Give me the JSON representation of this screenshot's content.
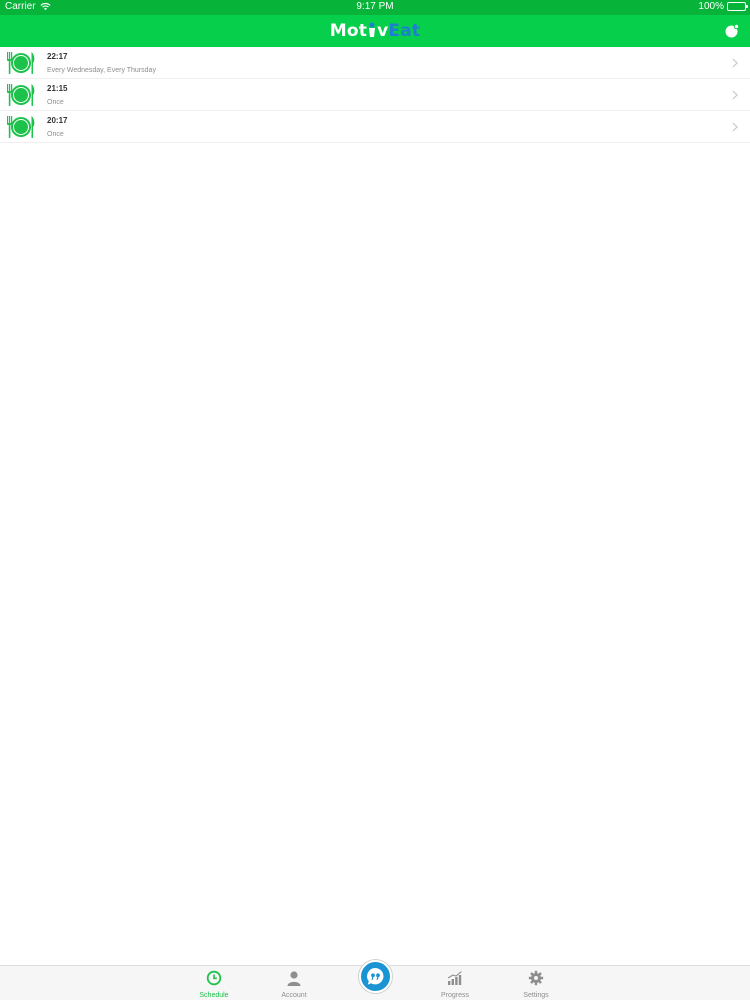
{
  "status_bar": {
    "carrier": "Carrier",
    "time": "9:17 PM",
    "battery": "100%"
  },
  "nav": {
    "logo_part1": "Mot",
    "logo_part2": "v",
    "logo_part3": "Eat",
    "logo_colors": {
      "primary": "#ffffff",
      "secondary": "#1e7fd0"
    },
    "right_icon": "notification-bell-icon"
  },
  "colors": {
    "accent": "#06d04b",
    "status_bar": "#08b33a",
    "active_tab": "#1cc24b",
    "center_button": "#1b94d3"
  },
  "schedule": [
    {
      "time": "22:17",
      "repeat": "Every Wednesday, Every Thursday",
      "icon": "meal-plate-icon"
    },
    {
      "time": "21:15",
      "repeat": "Once",
      "icon": "meal-plate-icon"
    },
    {
      "time": "20:17",
      "repeat": "Once",
      "icon": "meal-plate-icon"
    }
  ],
  "tabs": [
    {
      "label": "Schedule",
      "icon": "clock-icon",
      "active": true
    },
    {
      "label": "Account",
      "icon": "person-icon",
      "active": false
    },
    {
      "label": "",
      "icon": "quote-bubble-icon",
      "active": false
    },
    {
      "label": "Progress",
      "icon": "bar-chart-icon",
      "active": false
    },
    {
      "label": "Settings",
      "icon": "gear-icon",
      "active": false
    }
  ]
}
